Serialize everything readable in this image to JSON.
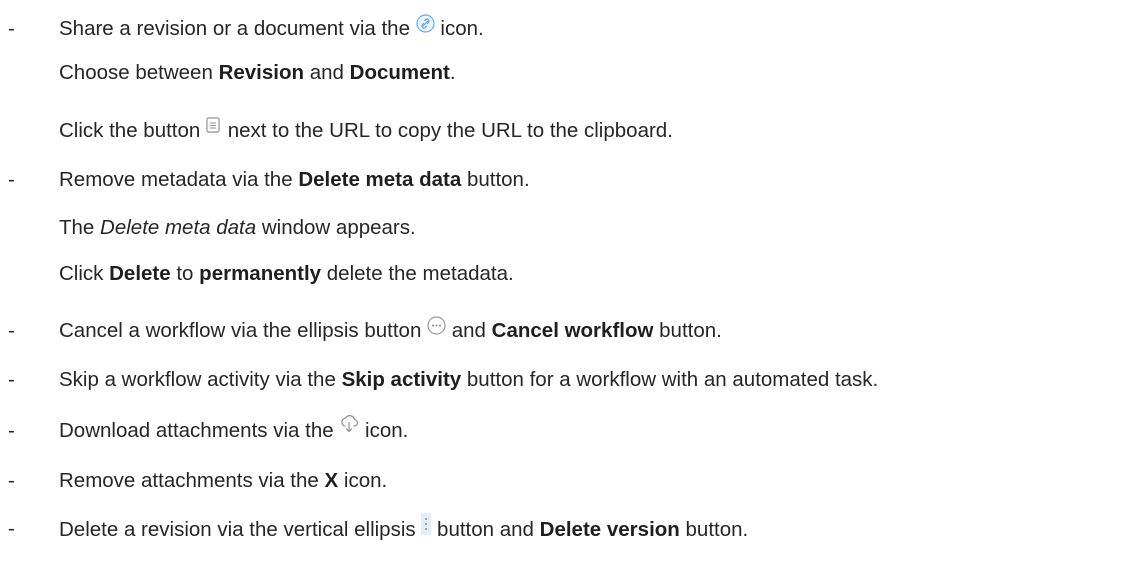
{
  "list_marker": "-",
  "items": [
    {
      "lines": [
        {
          "t1": "Share a revision or a document via the",
          "t2": "icon."
        },
        {
          "t1": "Choose between",
          "b1": "Revision",
          "t2": "and",
          "b2": "Document",
          "t3": "."
        },
        {
          "t1": "Click the button",
          "t2": "next to the URL to copy the URL to the clipboard."
        }
      ]
    },
    {
      "lines": [
        {
          "t1": "Remove metadata via the",
          "b1": "Delete meta data",
          "t2": "button."
        },
        {
          "t1": "The",
          "i1": "Delete meta data",
          "t2": "window appears."
        },
        {
          "t1": "Click",
          "b1": "Delete",
          "t2": "to",
          "b2": "permanently",
          "t3": "delete the metadata."
        }
      ]
    },
    {
      "lines": [
        {
          "t1": "Cancel a workflow via the ellipsis button",
          "t2": "and",
          "b1": "Cancel workflow",
          "t3": "button."
        }
      ]
    },
    {
      "lines": [
        {
          "t1": "Skip a workflow activity via the",
          "b1": "Skip activity",
          "t2": "button for a workflow with an automated task."
        }
      ]
    },
    {
      "lines": [
        {
          "t1": "Download attachments via the",
          "t2": "icon."
        }
      ]
    },
    {
      "lines": [
        {
          "t1": "Remove attachments via the",
          "b1": "X",
          "t2": "icon."
        }
      ]
    },
    {
      "lines": [
        {
          "t1": "Delete a revision via the vertical ellipsis",
          "t2": "button and",
          "b1": "Delete version",
          "t3": "button."
        }
      ]
    }
  ],
  "icons": {
    "share": "share-link-icon",
    "copy": "copy-icon",
    "ellipsis": "ellipsis-icon",
    "download": "download-icon",
    "vertical_ellipsis": "vertical-ellipsis-icon"
  },
  "colors": {
    "text": "#262626",
    "share_icon": "#6ea8f0",
    "muted_icon": "#9a9a9a",
    "vertical_ellipsis_bg": "#e4eefb"
  }
}
